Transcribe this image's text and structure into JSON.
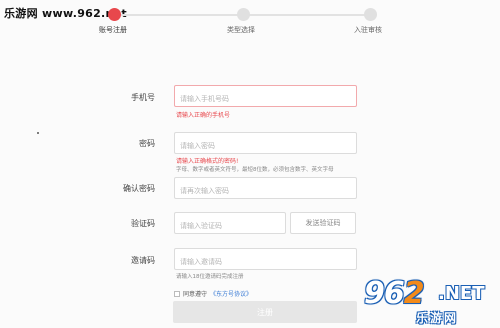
{
  "watermark": {
    "site": "乐游网 www.962.net"
  },
  "stepper": {
    "steps": [
      {
        "label": "账号注册",
        "active": true
      },
      {
        "label": "类型选择",
        "active": false
      },
      {
        "label": "入驻审核",
        "active": false
      }
    ]
  },
  "form": {
    "phone": {
      "label": "手机号",
      "placeholder": "请输入手机号码",
      "error": "请输入正确的手机号"
    },
    "password": {
      "label": "密码",
      "placeholder": "请输入密码",
      "error": "请输入正确格式的密码!",
      "hint": "字母、数字或者英文符号，最短8位数，必须包含数字、英文字母"
    },
    "confirm": {
      "label": "确认密码",
      "placeholder": "请再次输入密码"
    },
    "code": {
      "label": "验证码",
      "placeholder": "请输入验证码",
      "send_label": "发送验证码"
    },
    "invite": {
      "label": "邀请码",
      "placeholder": "请输入邀请码",
      "hint": "请输入18位邀请码完成注册"
    },
    "agree": {
      "prefix": "同意遵守",
      "link": "《东方号协议》"
    },
    "submit_label": "注册"
  },
  "logo": {
    "main_left": "96",
    "main_right": "2",
    "net": ".NET",
    "sub": "乐游网"
  },
  "colors": {
    "accent": "#e8474c",
    "link": "#3a7bd5",
    "disabled_button": "#e6e6e6"
  }
}
